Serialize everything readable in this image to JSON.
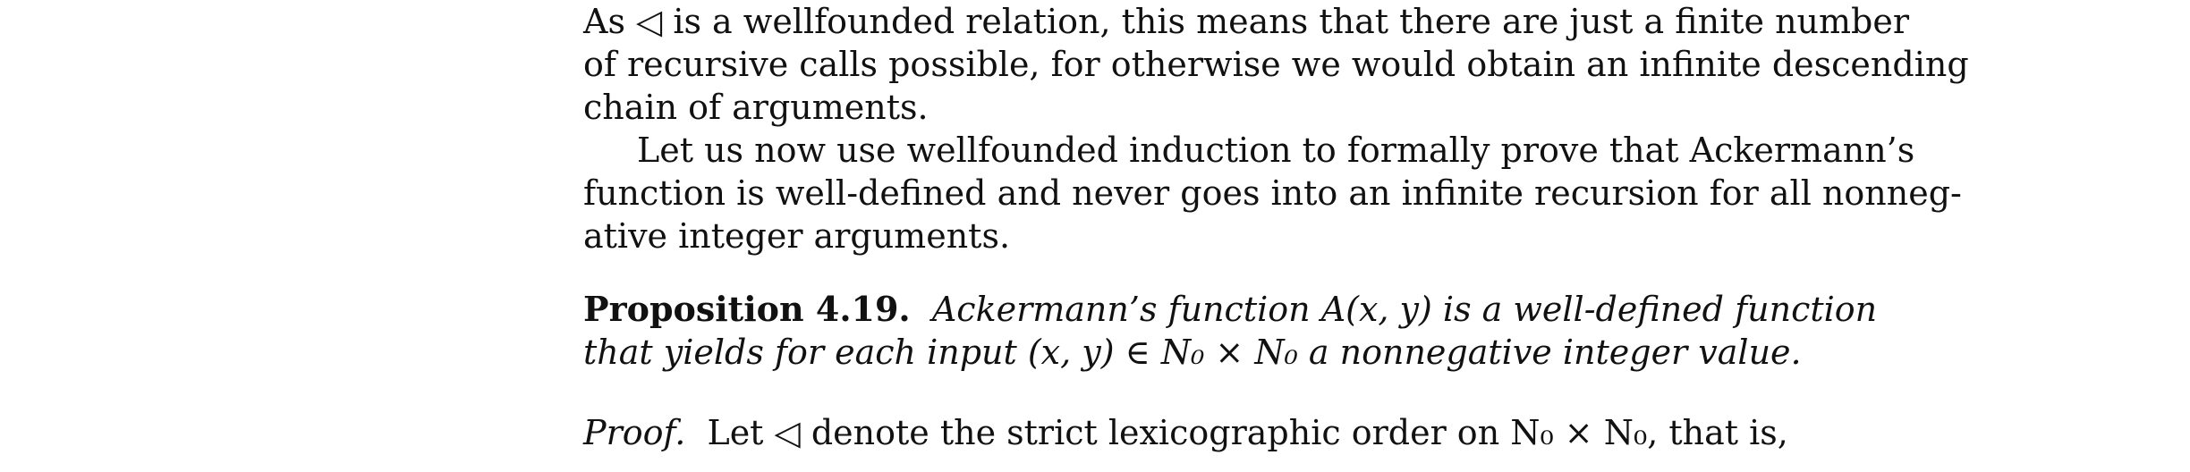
{
  "paragraph1": {
    "lines": [
      "As ◁ is a wellfounded relation, this means that there are just a finite number",
      "of recursive calls possible, for otherwise we would obtain an infinite descending",
      "chain of arguments."
    ]
  },
  "paragraph2": {
    "lines": [
      "Let us now use wellfounded induction to formally prove that Ackermann’s",
      "function is well-defined and never goes into an infinite recursion for all nonneg-",
      "ative integer arguments."
    ]
  },
  "proposition": {
    "label": "Proposition 4.19.",
    "line1_text": "Ackermann’s function A(x, y) is a well-defined function",
    "line2_text": "that yields for each input (x, y) ∈ N₀ × N₀ a nonnegative integer value."
  },
  "proof": {
    "label": "Proof.",
    "text": "Let ◁ denote the strict lexicographic order on N₀ × N₀, that is,"
  }
}
